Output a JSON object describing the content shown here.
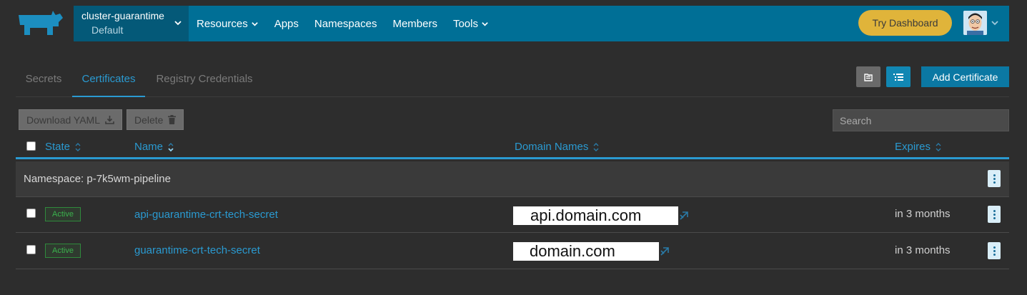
{
  "header": {
    "cluster_name": "cluster-guarantime",
    "project_name": "Default",
    "nav": [
      {
        "label": "Resources",
        "dropdown": true
      },
      {
        "label": "Apps",
        "dropdown": false
      },
      {
        "label": "Namespaces",
        "dropdown": false
      },
      {
        "label": "Members",
        "dropdown": false
      },
      {
        "label": "Tools",
        "dropdown": true
      }
    ],
    "try_dashboard": "Try Dashboard"
  },
  "tabs": [
    {
      "label": "Secrets",
      "active": false
    },
    {
      "label": "Certificates",
      "active": true
    },
    {
      "label": "Registry Credentials",
      "active": false
    }
  ],
  "toolbar": {
    "add_label": "Add Certificate",
    "download_label": "Download YAML",
    "delete_label": "Delete",
    "search_placeholder": "Search"
  },
  "table": {
    "columns": {
      "state": "State",
      "name": "Name",
      "domains": "Domain Names",
      "expires": "Expires"
    },
    "group_label": "Namespace: p-7k5wm-pipeline",
    "rows": [
      {
        "state": "Active",
        "name": "api-guarantime-crt-tech-secret",
        "domain": "api.domain.com",
        "expires": "in 3 months"
      },
      {
        "state": "Active",
        "name": "guarantime-crt-tech-secret",
        "domain": "domain.com",
        "expires": "in 3 months"
      }
    ]
  },
  "colors": {
    "accent": "#2a9ad1",
    "topbar": "#006f96",
    "cluster_bg": "#045978",
    "try_dashboard": "#e0b43a",
    "active_badge": "#3bb24d",
    "page_bg": "#2d2d2d"
  }
}
